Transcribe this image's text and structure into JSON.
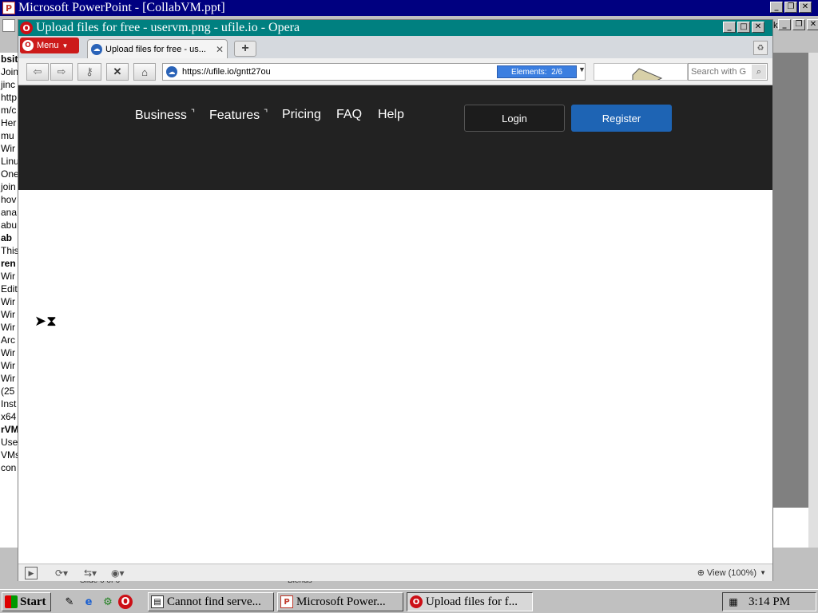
{
  "powerpoint": {
    "title": "Microsoft PowerPoint - [CollabVM.ppt]",
    "left_text": [
      "bsit",
      "Join",
      "jinc",
      "http",
      "m/c",
      "Her",
      "mu",
      "Wir",
      "Linu",
      "One",
      "join",
      "hov",
      "ana",
      "abu",
      "ab",
      "This",
      "ren",
      "Wir",
      "Edit",
      "Wir",
      "Wir",
      "Wir",
      "Arc",
      "Wir",
      "Wir",
      "Wir",
      "(25",
      "Inst",
      "x64",
      "rVM",
      "Use",
      "VMs",
      "con"
    ],
    "status_slide": "Slide 6 of 6",
    "status_design": "Blends",
    "menubar_partial": "ks ▾"
  },
  "opera": {
    "title": "Upload files for free - uservm.png - ufile.io - Opera",
    "menu_label": "Menu",
    "tab_label": "Upload files for free - us...",
    "url": "https://ufile.io/gntt27ou",
    "elements_label": "Elements:",
    "elements_count": "2/6",
    "search_placeholder": "Search with G",
    "zoom_label": "View (100%)"
  },
  "site": {
    "nav": [
      {
        "label": "Business",
        "caret": true
      },
      {
        "label": "Features",
        "caret": true
      },
      {
        "label": "Pricing"
      },
      {
        "label": "FAQ"
      },
      {
        "label": "Help"
      }
    ],
    "login_label": "Login",
    "register_label": "Register"
  },
  "taskbar": {
    "start_label": "Start",
    "tasks": [
      {
        "label": "Cannot find serve..."
      },
      {
        "label": "Microsoft Power..."
      },
      {
        "label": "Upload files for f..."
      }
    ],
    "clock": "3:14 PM"
  },
  "icons": {
    "pp_app": "powerpoint-icon",
    "opera_app": "opera-icon",
    "site_favicon": "ufile-cloud-icon",
    "nav_back": "back-arrow-icon",
    "nav_forward": "forward-arrow-icon",
    "nav_key": "key-icon",
    "nav_stop": "stop-x-icon",
    "nav_home": "home-icon"
  },
  "colors": {
    "title_active": "#008080",
    "title_inactive": "#000080",
    "site_header": "#222222",
    "register_button": "#1e64b4",
    "opera_menu": "#cc1a1a",
    "elements_badge": "#3b7ee0"
  }
}
